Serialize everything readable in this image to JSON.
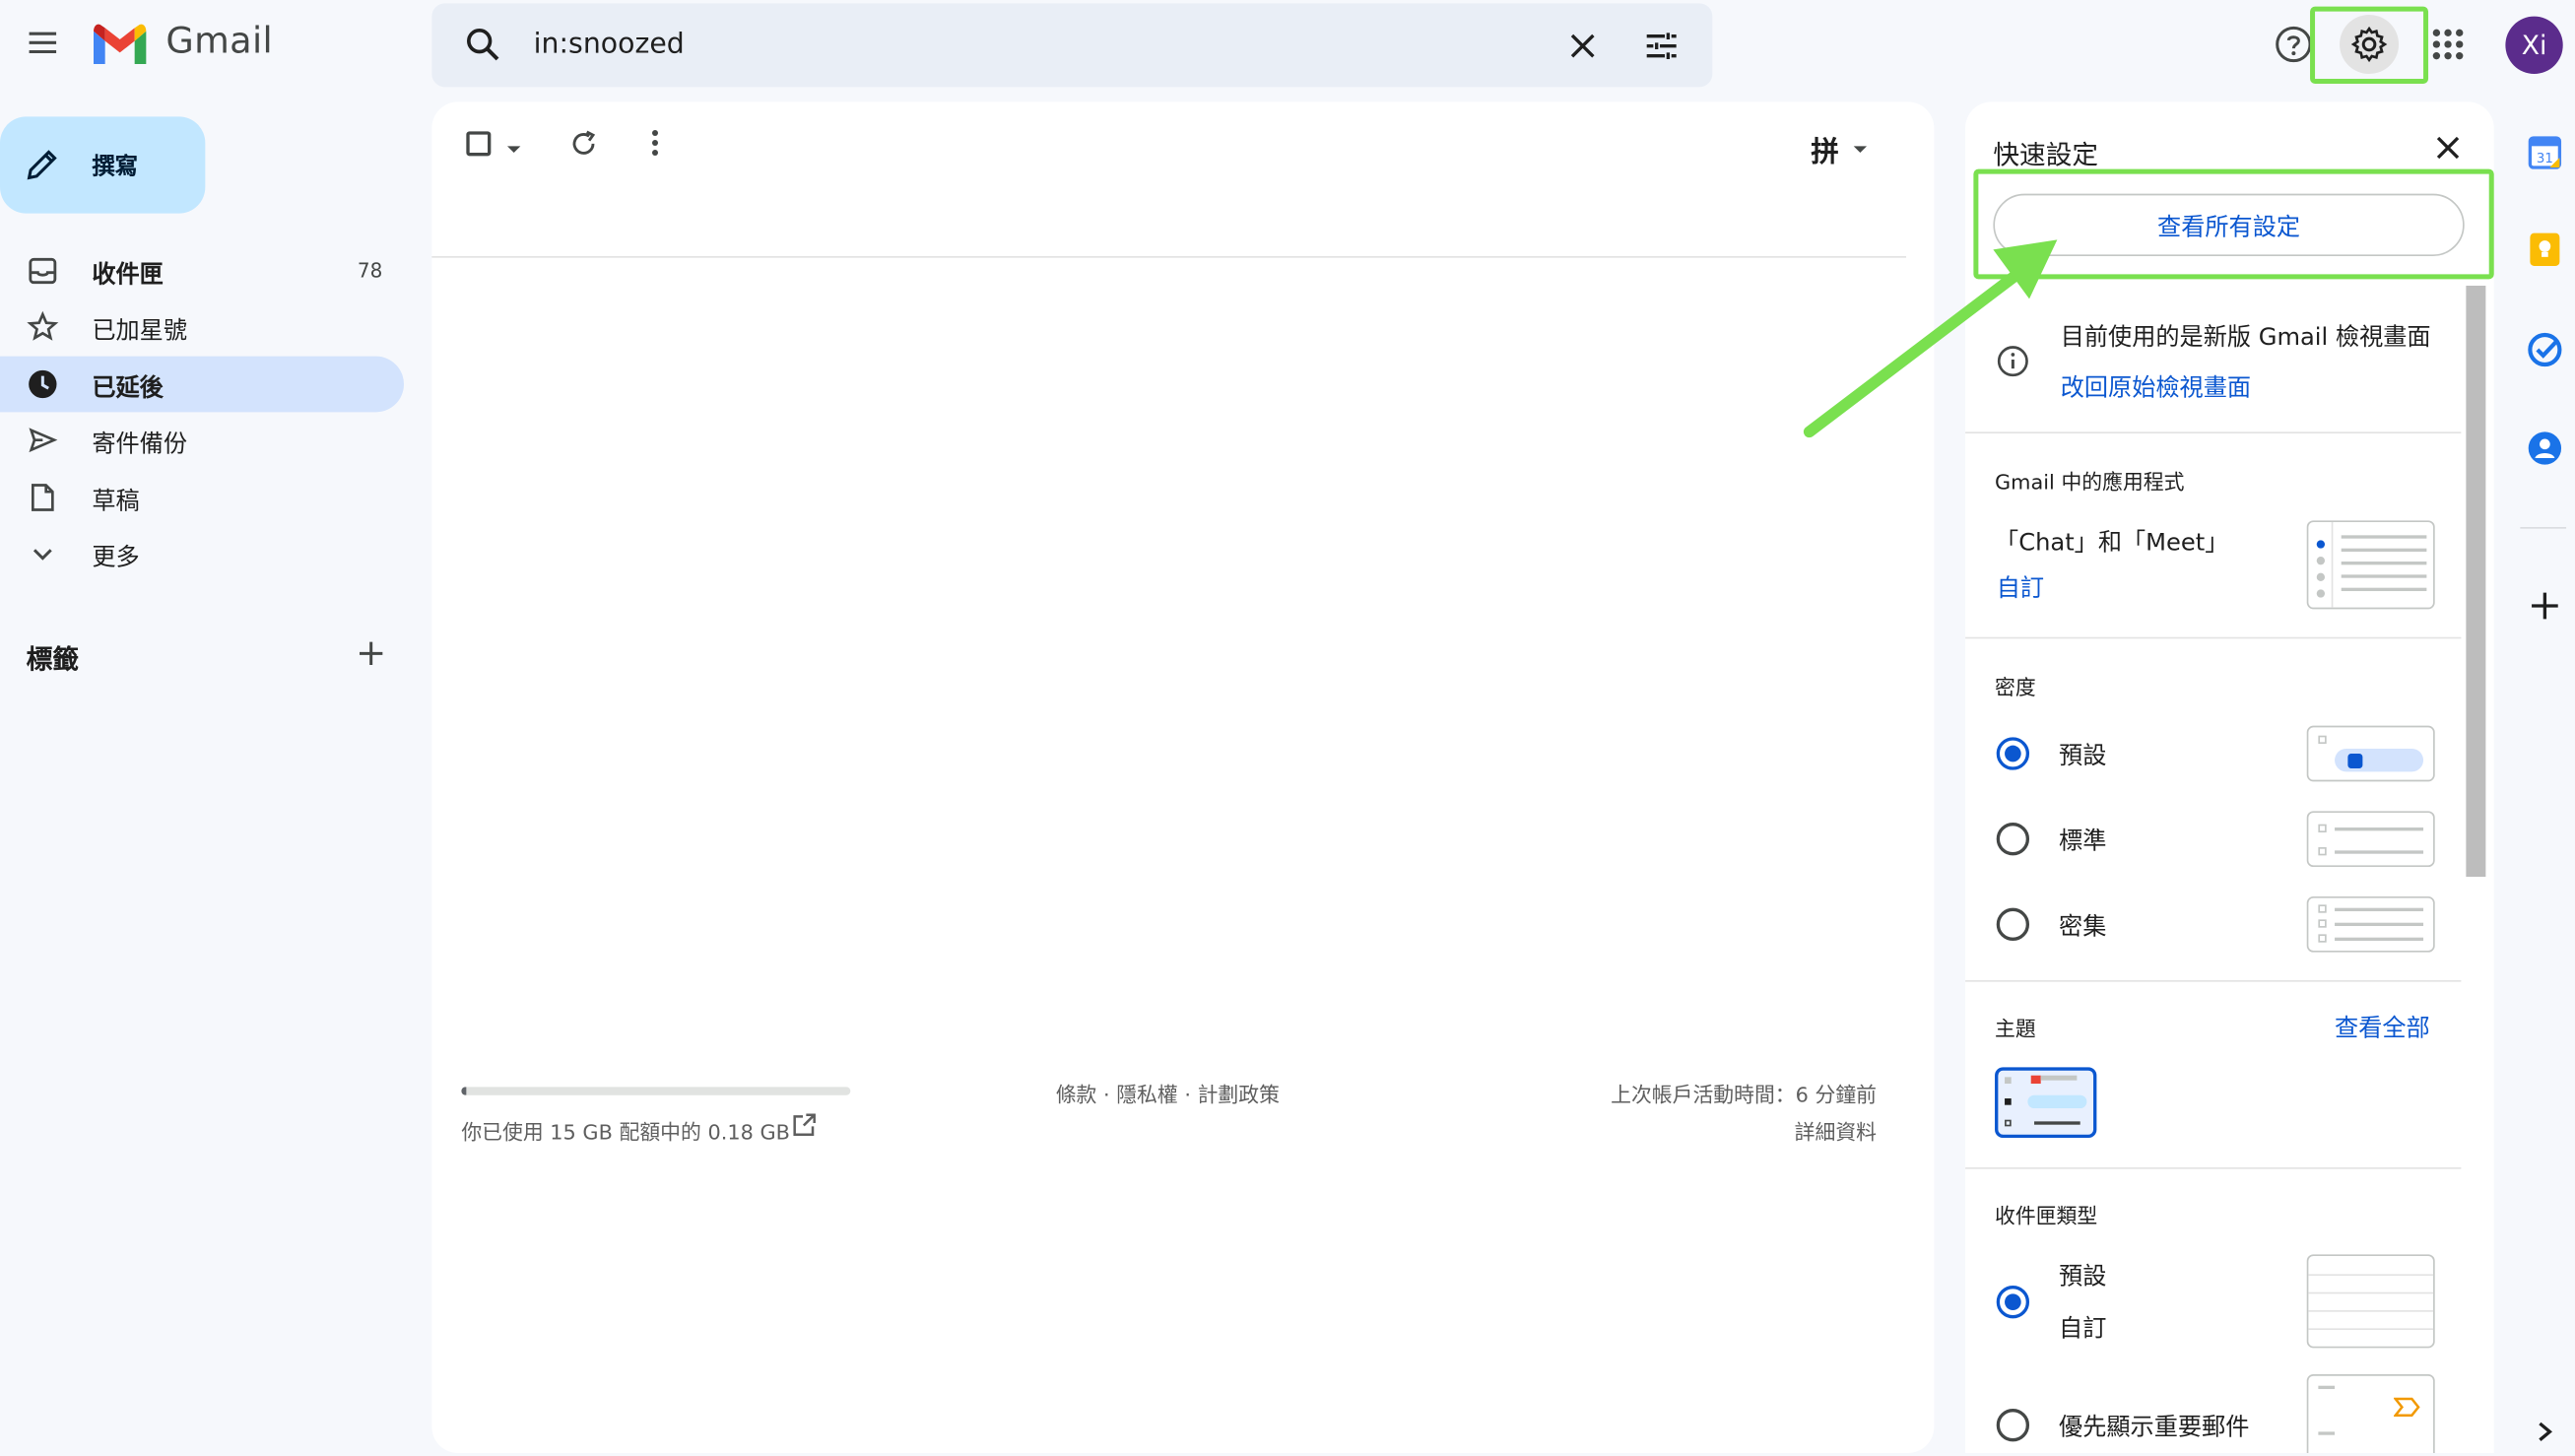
{
  "header": {
    "app_name": "Gmail",
    "search_value": "in:snoozed",
    "avatar_initials": "Xi",
    "icons": [
      "main-menu-icon",
      "gmail-logo",
      "search-icon",
      "clear-search-icon",
      "search-options-icon",
      "help-icon",
      "settings-icon",
      "apps-icon"
    ]
  },
  "sidebar": {
    "compose_label": "撰寫",
    "items": [
      {
        "label": "收件匣",
        "count": "78",
        "icon": "inbox-icon"
      },
      {
        "label": "已加星號",
        "count": "",
        "icon": "star-icon"
      },
      {
        "label": "已延後",
        "count": "",
        "icon": "clock-icon"
      },
      {
        "label": "寄件備份",
        "count": "",
        "icon": "send-icon"
      },
      {
        "label": "草稿",
        "count": "",
        "icon": "draft-icon"
      },
      {
        "label": "更多",
        "count": "",
        "icon": "chevron-down-icon"
      }
    ],
    "labels_title": "標籤"
  },
  "toolbar": {
    "input_tool_label": "拼"
  },
  "footer": {
    "storage_text": "你已使用 15 GB 配額中的 0.18 GB",
    "storage_used_fraction": 0.012,
    "policy_links": "條款 · 隱私權 · 計劃政策",
    "last_activity": "上次帳戶活動時間：6 分鐘前",
    "details_link": "詳細資料"
  },
  "quick_settings": {
    "title": "快速設定",
    "see_all_button": "查看所有設定",
    "info_text": "目前使用的是新版 Gmail 檢視畫面",
    "revert_link": "改回原始檢視畫面",
    "apps_section_title": "Gmail 中的應用程式",
    "apps_value": "「Chat」和「Meet」",
    "apps_customize": "自訂",
    "density_title": "密度",
    "density_options": [
      {
        "label": "預設",
        "selected": true
      },
      {
        "label": "標準",
        "selected": false
      },
      {
        "label": "密集",
        "selected": false
      }
    ],
    "theme_title": "主題",
    "theme_view_all": "查看全部",
    "inbox_type_title": "收件匣類型",
    "inbox_type_options": [
      {
        "label": "預設",
        "selected": true,
        "sub_link": "自訂"
      },
      {
        "label": "優先顯示重要郵件",
        "selected": false,
        "sub_link": ""
      }
    ]
  },
  "colors": {
    "accent_blue": "#0b57d0",
    "nav_active_bg": "#d3e3fd",
    "compose_bg": "#c2e7ff",
    "avatar_bg": "#5b2c8c",
    "annotation_green": "#7ae04f"
  }
}
